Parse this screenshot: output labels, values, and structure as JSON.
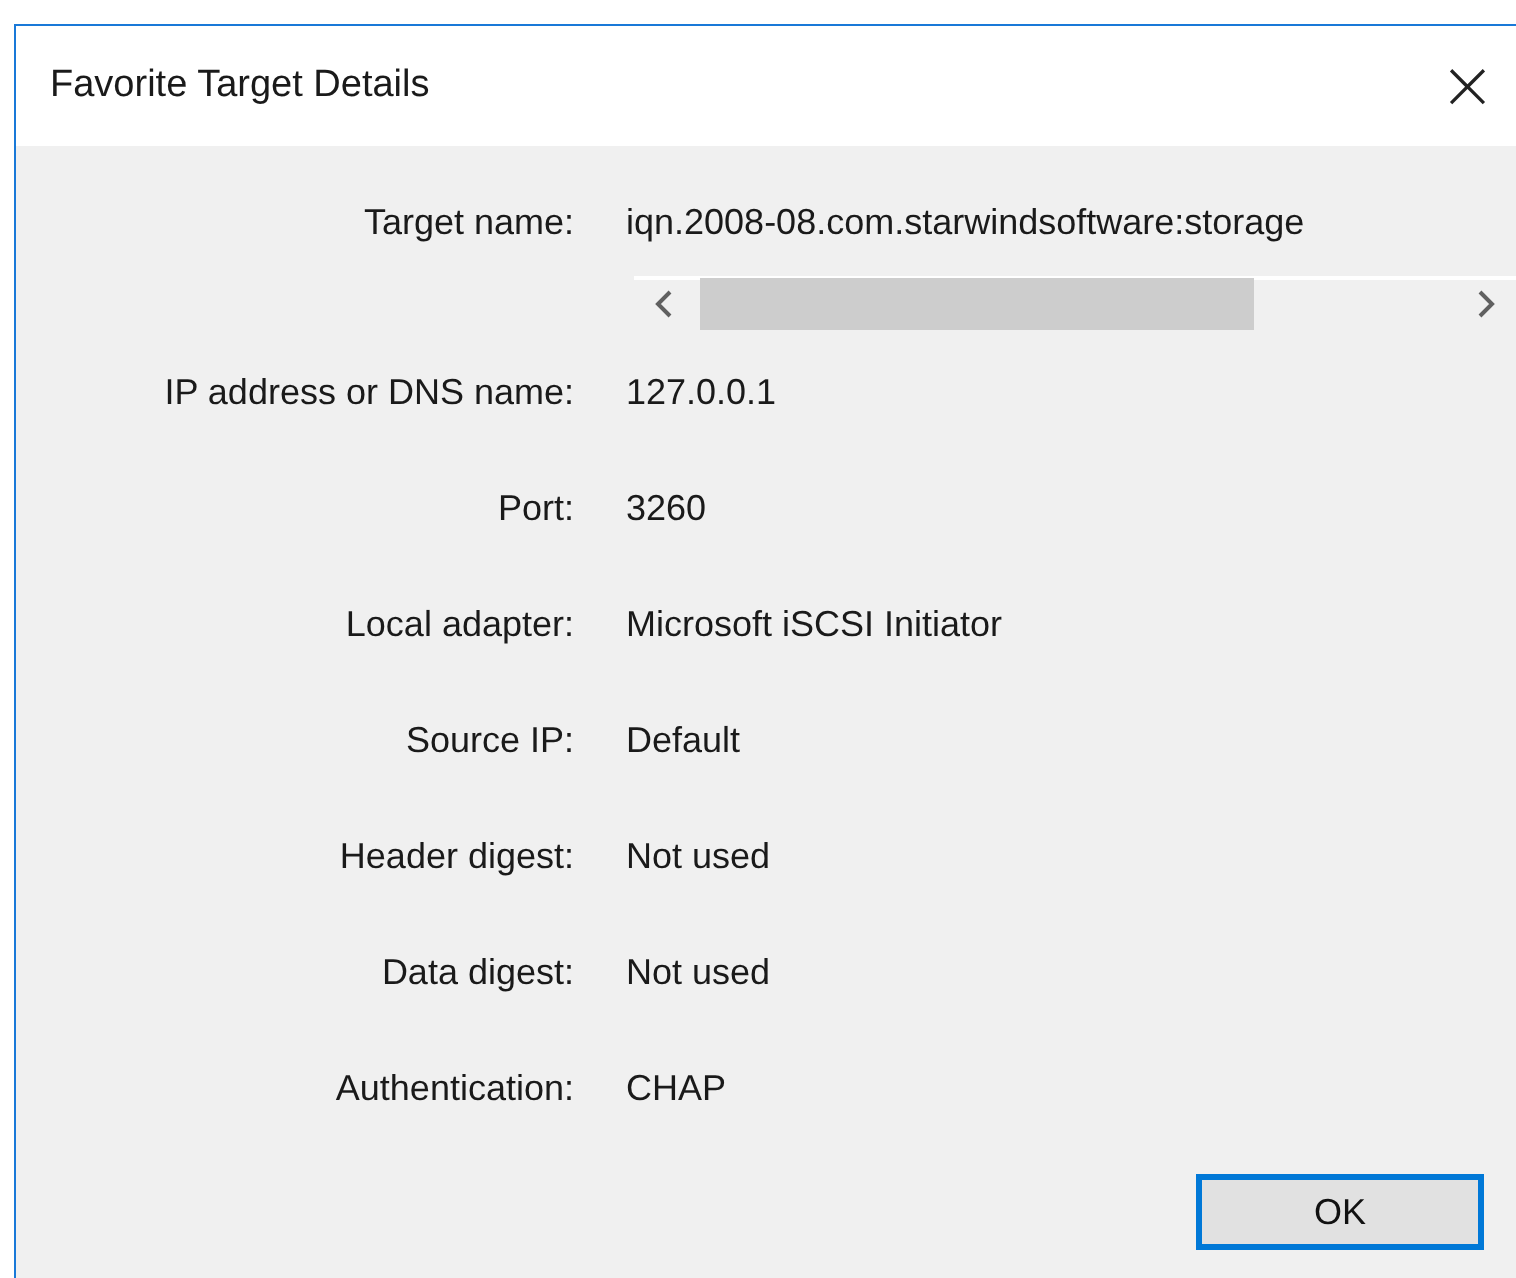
{
  "window": {
    "title": "Favorite Target Details",
    "close": "×"
  },
  "fields": [
    {
      "label": "Target name:",
      "value": "iqn.2008-08.com.starwindsoftware:storage",
      "kind": "scroll"
    },
    {
      "label": "IP address or DNS name:",
      "value": "127.0.0.1",
      "kind": "text"
    },
    {
      "label": "Port:",
      "value": "3260",
      "kind": "text"
    },
    {
      "label": "Local adapter:",
      "value": "Microsoft iSCSI Initiator",
      "kind": "text"
    },
    {
      "label": "Source IP:",
      "value": "Default",
      "kind": "text"
    },
    {
      "label": "Header digest:",
      "value": "Not used",
      "kind": "text"
    },
    {
      "label": "Data digest:",
      "value": "Not used",
      "kind": "text"
    },
    {
      "label": "Authentication:",
      "value": "CHAP",
      "kind": "text"
    }
  ],
  "buttons": [
    {
      "label": "OK",
      "selected": true
    }
  ]
}
